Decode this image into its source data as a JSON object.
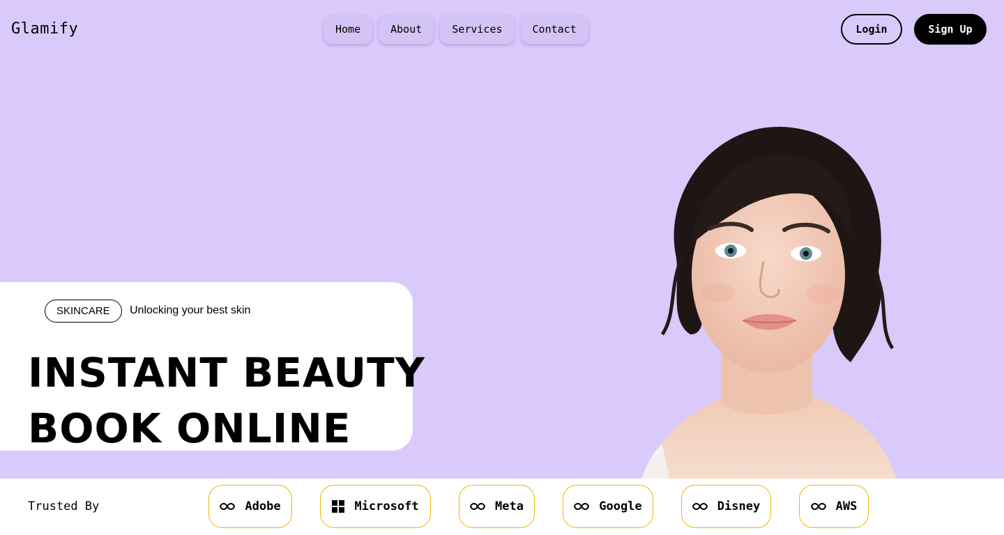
{
  "brand": "Glamify",
  "nav": [
    {
      "label": "Home"
    },
    {
      "label": "About"
    },
    {
      "label": "Services"
    },
    {
      "label": "Contact"
    }
  ],
  "auth": {
    "login": "Login",
    "signup": "Sign Up"
  },
  "hero": {
    "tag": "SKINCARE",
    "tagline": "Unlocking your best skin",
    "headline_line1": "INSTANT BEAUTY",
    "headline_line2": "BOOK ONLINE"
  },
  "trusted": {
    "label": "Trusted By",
    "brands": [
      {
        "name": "Adobe",
        "icon": "infinity-icon"
      },
      {
        "name": "Microsoft",
        "icon": "windows-grid-icon"
      },
      {
        "name": "Meta",
        "icon": "infinity-icon"
      },
      {
        "name": "Google",
        "icon": "infinity-icon"
      },
      {
        "name": "Disney",
        "icon": "infinity-icon"
      },
      {
        "name": "AWS",
        "icon": "infinity-icon"
      }
    ]
  },
  "colors": {
    "background": "#dac9fb",
    "nav_button": "#d4c3f5",
    "pill_border": "#f0b400",
    "primary_button": "#000000"
  }
}
